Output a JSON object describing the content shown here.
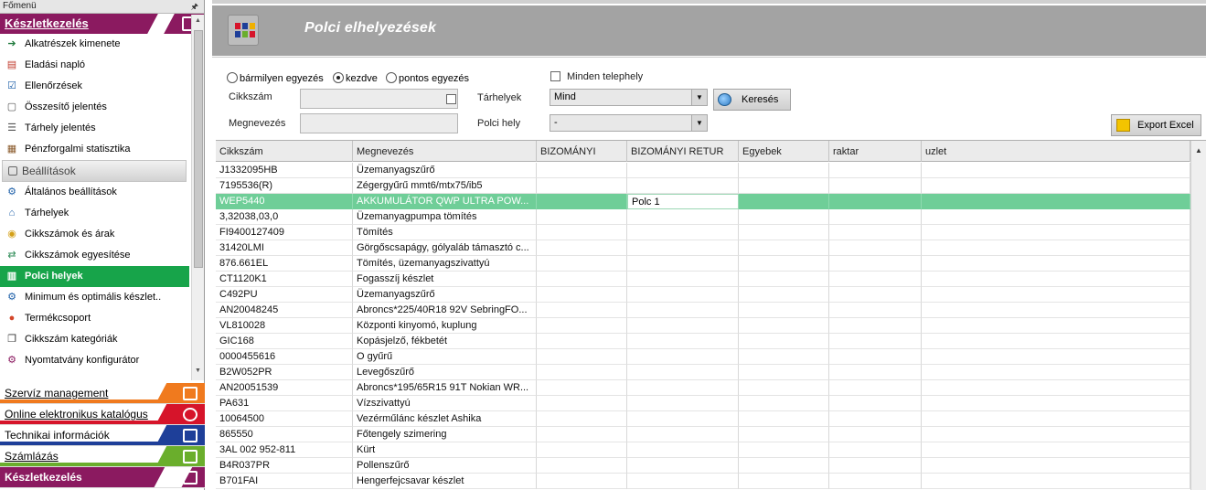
{
  "sidebar": {
    "menu_title": "Főmenü",
    "pin_icon": "pin-icon",
    "section_title": "Készletkezelés",
    "items": [
      {
        "label": "Alkatrészek kimenete",
        "icon": "parts-output-icon"
      },
      {
        "label": "Eladási napló",
        "icon": "sales-log-icon"
      },
      {
        "label": "Ellenőrzések",
        "icon": "checks-icon"
      },
      {
        "label": "Összesítő jelentés",
        "icon": "summary-report-icon"
      },
      {
        "label": "Tárhely jelentés",
        "icon": "storage-report-icon"
      },
      {
        "label": "Pénzforgalmi statisztika",
        "icon": "cashflow-stats-icon"
      }
    ],
    "group_label": "Beállítások",
    "settings_items": [
      {
        "label": "Általános beállítások",
        "icon": "gear-icon"
      },
      {
        "label": "Tárhelyek",
        "icon": "storage-icon"
      },
      {
        "label": "Cikkszámok és árak",
        "icon": "price-icon"
      },
      {
        "label": "Cikkszámok egyesítése",
        "icon": "merge-icon"
      },
      {
        "label": "Polci helyek",
        "icon": "shelf-icon",
        "active": true
      },
      {
        "label": "Minimum és optimális készlet..",
        "icon": "stock-level-icon"
      },
      {
        "label": "Termékcsoport",
        "icon": "product-group-icon"
      },
      {
        "label": "Cikkszám kategóriák",
        "icon": "category-icon"
      },
      {
        "label": "Nyomtatvány konfigurátor",
        "icon": "print-config-icon"
      }
    ],
    "bottom_sections": [
      {
        "label": "Szervíz management",
        "color": "#f07a1e"
      },
      {
        "label": "Online elektronikus katalógus",
        "color": "#d6142a"
      },
      {
        "label": "Technikai információk",
        "color": "#1e3f99"
      },
      {
        "label": "Számlázás",
        "color": "#6aae2c"
      },
      {
        "label": "Készletkezelés",
        "color": "#8b1a60"
      }
    ]
  },
  "header": {
    "title": "Polci elhelyezések"
  },
  "filters": {
    "match_options": [
      "bármilyen egyezés",
      "kezdve",
      "pontos egyezés"
    ],
    "match_selected": "kezdve",
    "cikkszam_label": "Cikkszám",
    "cikkszam_value": "",
    "megnevezes_label": "Megnevezés",
    "megnevezes_value": "",
    "all_sites_label": "Minden telephely",
    "all_sites_checked": false,
    "tarhelyek_label": "Tárhelyek",
    "tarhelyek_value": "Mind",
    "polci_hely_label": "Polci hely",
    "polci_hely_value": "-",
    "search_button": "Keresés",
    "export_button": "Export Excel"
  },
  "grid": {
    "columns": [
      "Cikkszám",
      "Megnevezés",
      "BIZOMÁNYI",
      "BIZOMÁNYI RETUR",
      "Egyebek",
      "raktar",
      "uzlet"
    ],
    "selected_row": 2,
    "editing_value": "Polc 1",
    "rows": [
      [
        "J1332095HB",
        "Üzemanyagszűrő",
        "",
        "",
        "",
        "",
        ""
      ],
      [
        "7195536(R)",
        "Zégergyűrű mmt6/mtx75/ib5",
        "",
        "",
        "",
        "",
        ""
      ],
      [
        "WEP5440",
        "AKKUMULÁTOR QWP ULTRA POW...",
        "",
        "Polc 1",
        "",
        "",
        ""
      ],
      [
        "3,32038,03,0",
        "Üzemanyagpumpa tömítés",
        "",
        "",
        "",
        "",
        ""
      ],
      [
        "FI9400127409",
        "Tömítés",
        "",
        "",
        "",
        "",
        ""
      ],
      [
        "31420LMI",
        "Görgőscsapágy, gólyaláb támasztó c...",
        "",
        "",
        "",
        "",
        ""
      ],
      [
        "876.661EL",
        "Tömítés, üzemanyagszivattyú",
        "",
        "",
        "",
        "",
        ""
      ],
      [
        "CT1120K1",
        "Fogasszíj készlet",
        "",
        "",
        "",
        "",
        ""
      ],
      [
        "C492PU",
        "Üzemanyagszűrő",
        "",
        "",
        "",
        "",
        ""
      ],
      [
        "AN20048245",
        "Abroncs*225/40R18 92V SebringFO...",
        "",
        "",
        "",
        "",
        ""
      ],
      [
        "VL810028",
        "Központi kinyomó, kuplung",
        "",
        "",
        "",
        "",
        ""
      ],
      [
        "GIC168",
        "Kopásjelző, fékbetét",
        "",
        "",
        "",
        "",
        ""
      ],
      [
        "0000455616",
        "O gyűrű",
        "",
        "",
        "",
        "",
        ""
      ],
      [
        "B2W052PR",
        "Levegőszűrő",
        "",
        "",
        "",
        "",
        ""
      ],
      [
        "AN20051539",
        "Abroncs*195/65R15 91T Nokian WR...",
        "",
        "",
        "",
        "",
        ""
      ],
      [
        "PA631",
        "Vízszivattyú",
        "",
        "",
        "",
        "",
        ""
      ],
      [
        "10064500",
        "Vezérműlánc készlet Ashika",
        "",
        "",
        "",
        "",
        ""
      ],
      [
        "865550",
        "Főtengely szimering",
        "",
        "",
        "",
        "",
        ""
      ],
      [
        "3AL 002 952-811",
        "Kürt",
        "",
        "",
        "",
        "",
        ""
      ],
      [
        "B4R037PR",
        "Pollenszűrő",
        "",
        "",
        "",
        "",
        ""
      ],
      [
        "B701FAI",
        "Hengerfejcsavar készlet",
        "",
        "",
        "",
        "",
        ""
      ]
    ]
  }
}
